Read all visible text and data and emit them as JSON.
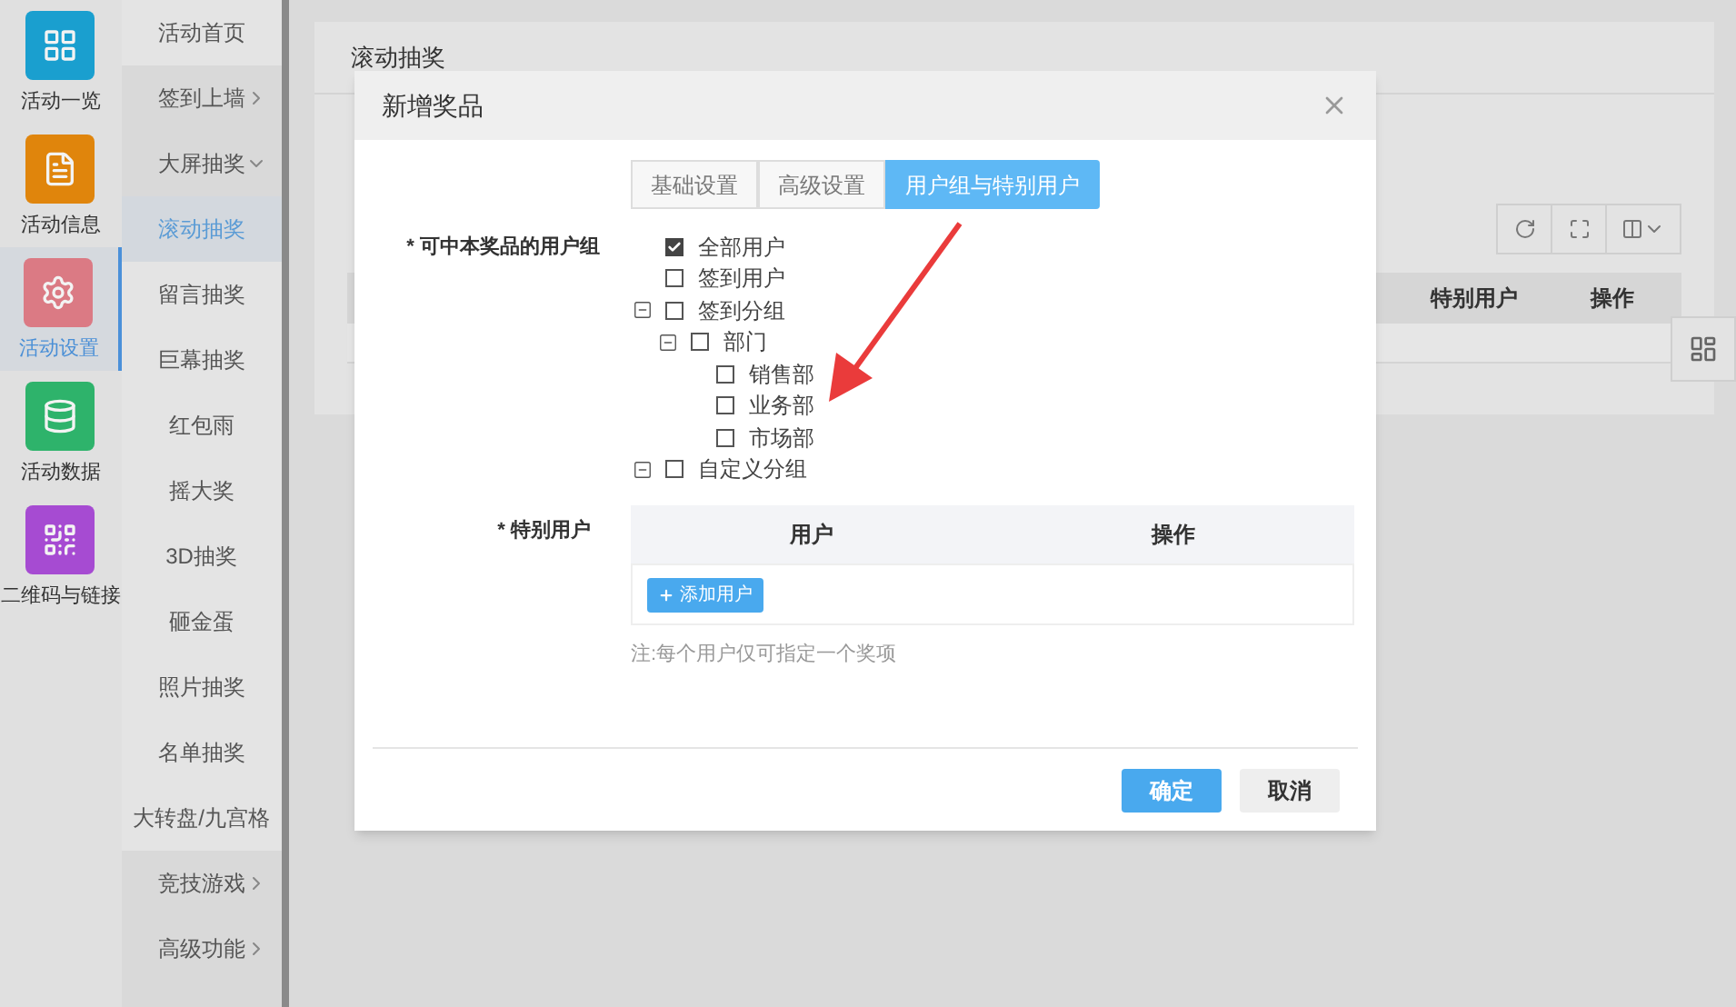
{
  "nav_rail": [
    {
      "label": "活动一览",
      "selected": false,
      "color": "#1a9fcf"
    },
    {
      "label": "活动信息",
      "selected": false,
      "color": "#e0850c"
    },
    {
      "label": "活动设置",
      "selected": true,
      "color": "#db7a84"
    },
    {
      "label": "活动数据",
      "selected": false,
      "color": "#2eb36b"
    },
    {
      "label": "二维码与链接",
      "selected": false,
      "color": "#a64bd2"
    }
  ],
  "submenu": [
    {
      "label": "活动首页",
      "selected": false
    },
    {
      "label": "签到上墙",
      "selected": false,
      "expanded": false
    },
    {
      "label": "大屏抽奖",
      "selected": false,
      "expanded": true,
      "children": [
        {
          "label": "滚动抽奖",
          "selected": true
        },
        {
          "label": "留言抽奖",
          "selected": false
        },
        {
          "label": "巨幕抽奖",
          "selected": false
        },
        {
          "label": "红包雨",
          "selected": false
        },
        {
          "label": "摇大奖",
          "selected": false
        },
        {
          "label": "3D抽奖",
          "selected": false
        },
        {
          "label": "砸金蛋",
          "selected": false
        },
        {
          "label": "照片抽奖",
          "selected": false
        },
        {
          "label": "名单抽奖",
          "selected": false
        },
        {
          "label": "大转盘/九宫格",
          "selected": false
        }
      ]
    },
    {
      "label": "竞技游戏",
      "selected": false,
      "expanded": false
    },
    {
      "label": "高级功能",
      "selected": false,
      "expanded": false
    }
  ],
  "page": {
    "title": "滚动抽奖",
    "table_columns": [
      "特别用户",
      "操作"
    ]
  },
  "dialog": {
    "title": "新增奖品",
    "tabs": [
      {
        "label": "基础设置",
        "selected": false
      },
      {
        "label": "高级设置",
        "selected": false
      },
      {
        "label": "用户组与特别用户",
        "selected": true
      }
    ],
    "user_group_label": "* 可中本奖品的用户组",
    "user_tree": [
      {
        "label": "全部用户",
        "checked": true
      },
      {
        "label": "签到用户",
        "checked": false
      },
      {
        "label": "签到分组",
        "checked": false,
        "expanded": true,
        "children": [
          {
            "label": "部门",
            "checked": false,
            "expanded": true,
            "children": [
              {
                "label": "销售部",
                "checked": false
              },
              {
                "label": "业务部",
                "checked": false
              },
              {
                "label": "市场部",
                "checked": false
              }
            ]
          }
        ]
      },
      {
        "label": "自定义分组",
        "checked": false,
        "expanded": true
      }
    ],
    "special_users_label": "* 特别用户",
    "special_users_columns": [
      "用户",
      "操作"
    ],
    "add_user_button": "添加用户",
    "note": "注:每个用户仅可指定一个奖项",
    "buttons": [
      {
        "label": "确定",
        "kind": "primary"
      },
      {
        "label": "取消",
        "kind": "default"
      }
    ]
  }
}
